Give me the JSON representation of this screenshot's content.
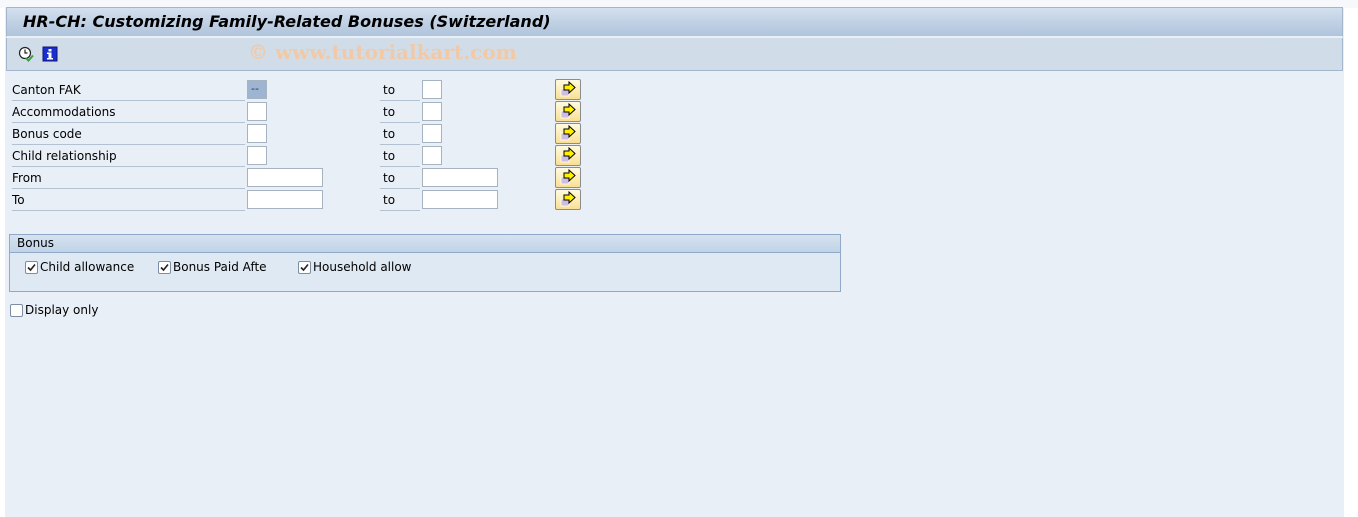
{
  "window": {
    "title": "HR-CH: Customizing Family-Related Bonuses (Switzerland)",
    "watermark": "© www.tutorialkart.com"
  },
  "toolbar": {
    "icons": [
      {
        "name": "execute-icon",
        "tooltip": "Execute"
      },
      {
        "name": "info-icon",
        "tooltip": "Information"
      }
    ]
  },
  "selection": {
    "to_label": "to",
    "rows": [
      {
        "label": "Canton FAK",
        "from_value": "--",
        "to_value": ""
      },
      {
        "label": "Accommodations",
        "from_value": "",
        "to_value": ""
      },
      {
        "label": "Bonus code",
        "from_value": "",
        "to_value": ""
      },
      {
        "label": "Child relationship",
        "from_value": "",
        "to_value": ""
      },
      {
        "label": "From",
        "from_value": "",
        "to_value": ""
      },
      {
        "label": "To",
        "from_value": "",
        "to_value": ""
      }
    ]
  },
  "bonus_group": {
    "title": "Bonus",
    "checkboxes": [
      {
        "label": "Child allowance",
        "checked": true
      },
      {
        "label": "Bonus Paid Afte",
        "checked": true
      },
      {
        "label": "Household allow",
        "checked": true
      }
    ]
  },
  "display_only": {
    "label": "Display only",
    "checked": false
  }
}
